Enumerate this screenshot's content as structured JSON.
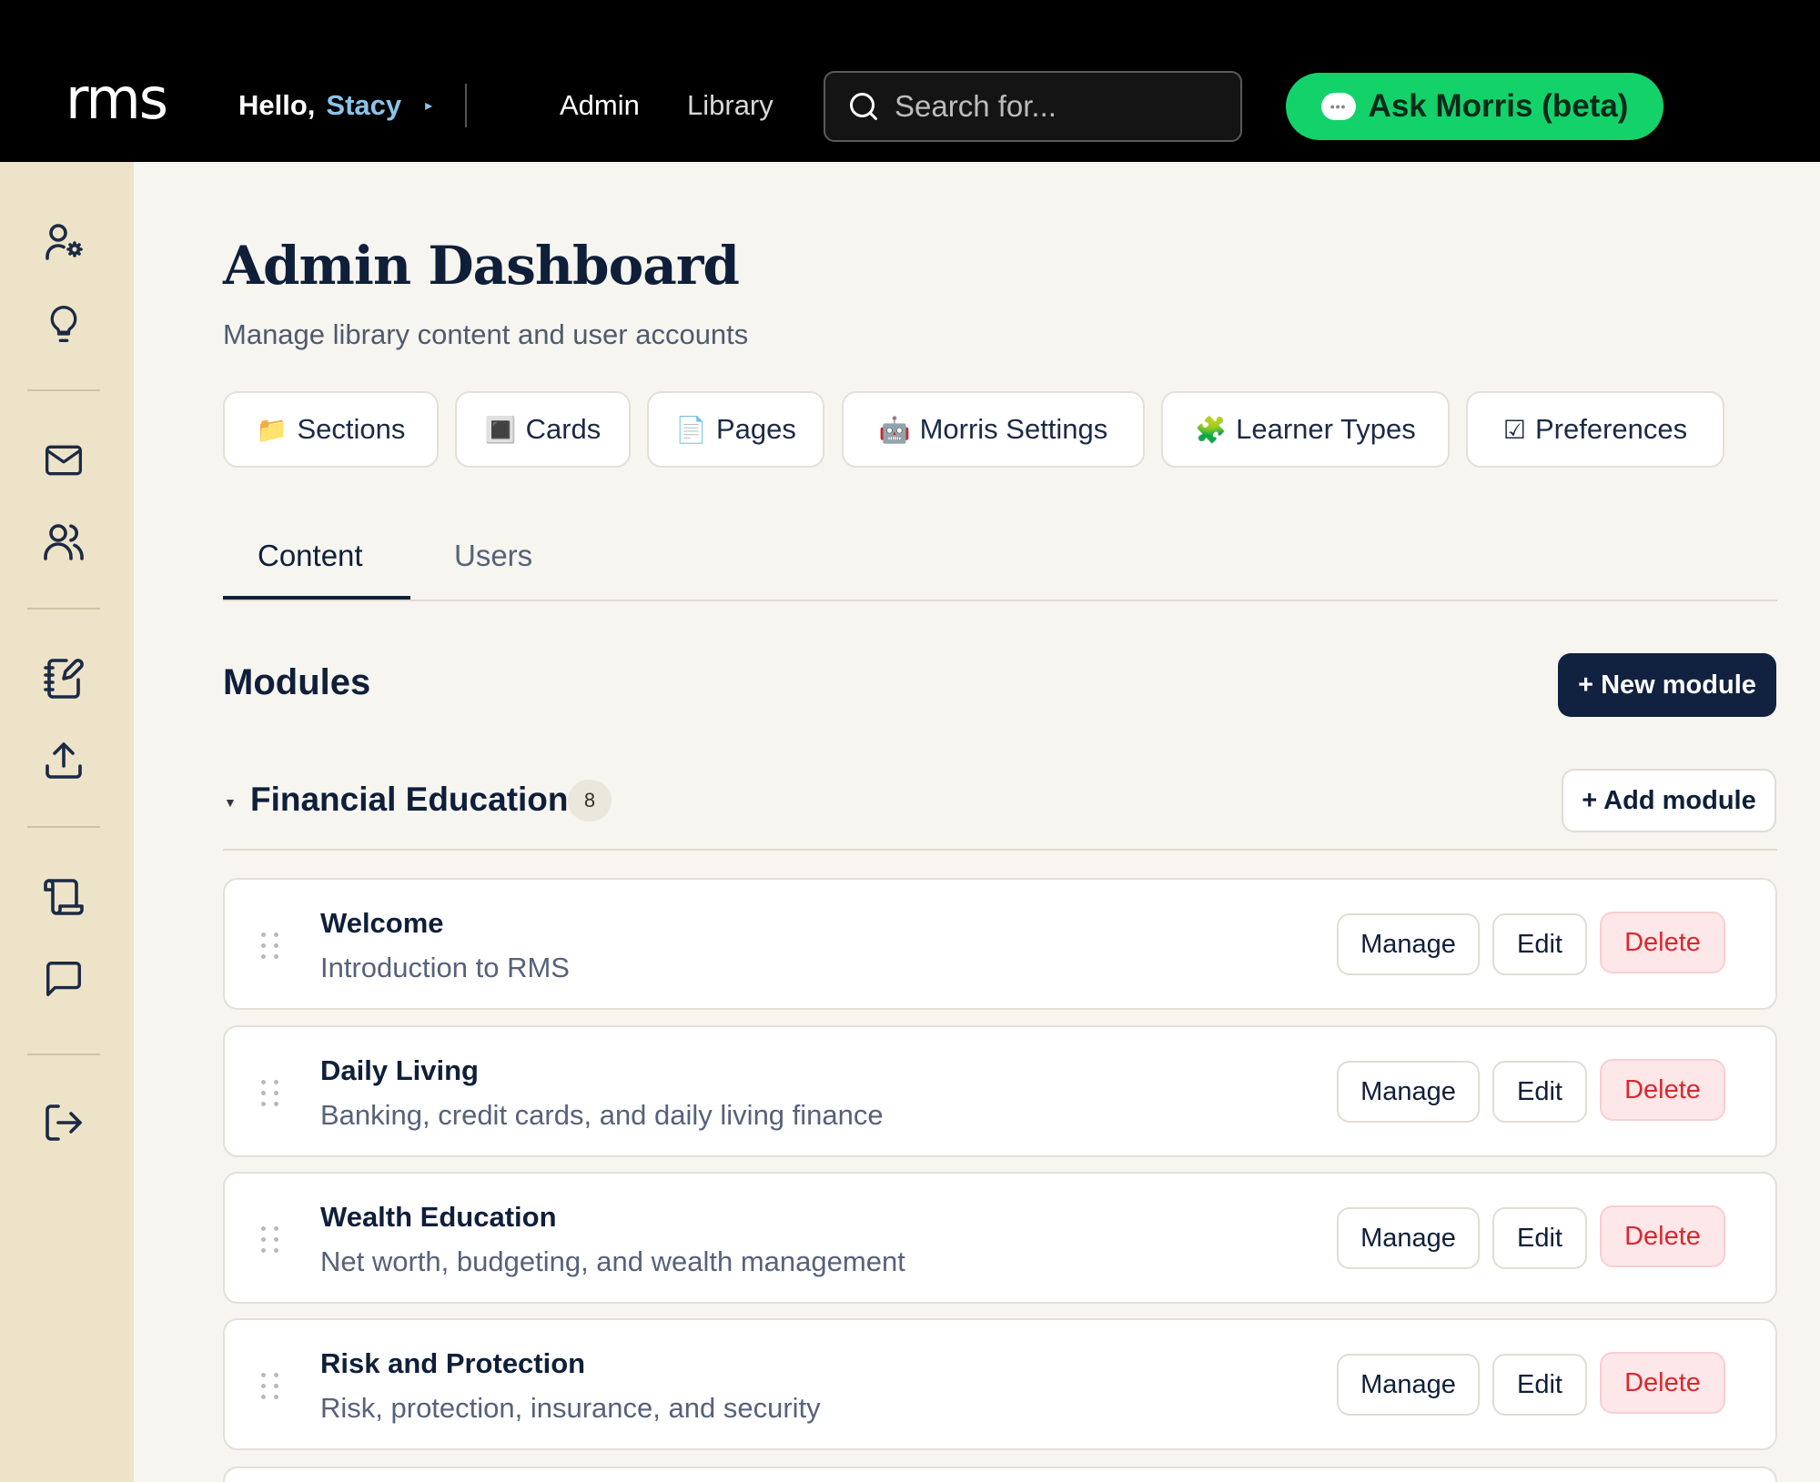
{
  "header": {
    "logo": "rms",
    "greeting": "Hello,",
    "user_name": "Stacy",
    "nav": [
      "Admin",
      "Library"
    ],
    "search_placeholder": "Search for...",
    "ask_button": "Ask Morris (beta)",
    "accent_color": "#14d26a"
  },
  "sidebar": {
    "icons": [
      "user-settings-icon",
      "lightbulb-icon",
      "mail-icon",
      "users-icon",
      "notebook-edit-icon",
      "upload-icon",
      "scroll-icon",
      "chat-icon",
      "logout-icon"
    ]
  },
  "page": {
    "title": "Admin Dashboard",
    "subtitle": "Manage library content and user accounts"
  },
  "quick_links": [
    {
      "emoji": "📁",
      "label": "Sections"
    },
    {
      "emoji": "🔳",
      "label": "Cards"
    },
    {
      "emoji": "📄",
      "label": "Pages"
    },
    {
      "emoji": "🤖",
      "label": "Morris Settings"
    },
    {
      "emoji": "🧩",
      "label": "Learner Types"
    },
    {
      "emoji": "☑",
      "label": "Preferences"
    }
  ],
  "tabs": [
    {
      "label": "Content",
      "active": true
    },
    {
      "label": "Users",
      "active": false
    }
  ],
  "modules": {
    "heading": "Modules",
    "new_button": "+ New module",
    "section": {
      "title": "Financial Education",
      "count": "8",
      "add_button": "+ Add module"
    },
    "actions": {
      "manage": "Manage",
      "edit": "Edit",
      "delete": "Delete"
    },
    "items": [
      {
        "title": "Welcome",
        "description": "Introduction to RMS"
      },
      {
        "title": "Daily Living",
        "description": "Banking, credit cards, and daily living finance"
      },
      {
        "title": "Wealth Education",
        "description": "Net worth, budgeting, and wealth management"
      },
      {
        "title": "Risk and Protection",
        "description": "Risk, protection, insurance, and security"
      }
    ]
  }
}
